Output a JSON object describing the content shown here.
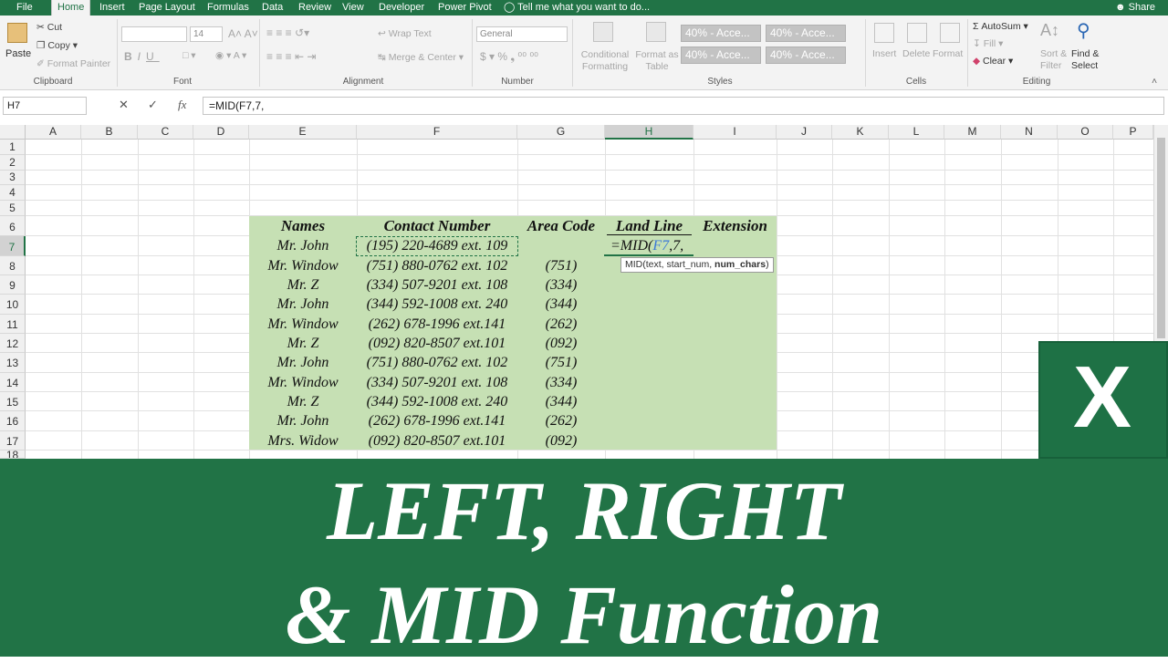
{
  "ribbon_tabs": [
    "File",
    "Home",
    "Insert",
    "Page Layout",
    "Formulas",
    "Data",
    "Review",
    "View",
    "Developer",
    "Power Pivot"
  ],
  "tell_me": "Tell me what you want to do...",
  "share": "Share",
  "clipboard": {
    "paste": "Paste",
    "cut": "Cut",
    "copy": "Copy",
    "format_painter": "Format Painter",
    "label": "Clipboard"
  },
  "font": {
    "size": "14",
    "label": "Font"
  },
  "alignment": {
    "wrap": "Wrap Text",
    "merge": "Merge & Center",
    "label": "Alignment"
  },
  "number": {
    "format": "General",
    "label": "Number"
  },
  "styles": {
    "conditional": "Conditional Formatting",
    "format_table": "Format as Table",
    "cell_styles": [
      "40% - Acce...",
      "40% - Acce...",
      "40% - Acce...",
      "40% - Acce..."
    ],
    "label": "Styles"
  },
  "cells": {
    "insert": "Insert",
    "delete": "Delete",
    "format": "Format",
    "label": "Cells"
  },
  "editing": {
    "autosum": "AutoSum",
    "fill": "Fill",
    "clear": "Clear",
    "sort": "Sort & Filter",
    "find": "Find & Select",
    "label": "Editing"
  },
  "formula_bar": {
    "name_box": "H7",
    "formula": "=MID(F7,7,"
  },
  "columns": [
    "A",
    "B",
    "C",
    "D",
    "E",
    "F",
    "G",
    "H",
    "I",
    "J",
    "K",
    "L",
    "M",
    "N",
    "O",
    "P"
  ],
  "rows": [
    "1",
    "2",
    "3",
    "4",
    "5",
    "6",
    "7",
    "8",
    "9",
    "10",
    "11",
    "12",
    "13",
    "14",
    "15",
    "16",
    "17",
    "18"
  ],
  "table": {
    "headers": [
      "Names",
      "Contact Number",
      "Area Code",
      "Land Line",
      "Extension"
    ],
    "rows": [
      {
        "name": "Mr. John",
        "contact": "(195) 220-4689 ext. 109",
        "area": ""
      },
      {
        "name": "Mr. Window",
        "contact": "(751) 880-0762 ext. 102",
        "area": "(751)"
      },
      {
        "name": "Mr. Z",
        "contact": "(334) 507-9201 ext. 108",
        "area": "(334)"
      },
      {
        "name": "Mr. John",
        "contact": "(344) 592-1008 ext. 240",
        "area": "(344)"
      },
      {
        "name": "Mr. Window",
        "contact": "(262) 678-1996 ext.141",
        "area": "(262)"
      },
      {
        "name": "Mr. Z",
        "contact": "(092) 820-8507 ext.101",
        "area": "(092)"
      },
      {
        "name": "Mr. John",
        "contact": "(751) 880-0762 ext. 102",
        "area": "(751)"
      },
      {
        "name": "Mr. Window",
        "contact": "(334) 507-9201 ext. 108",
        "area": "(334)"
      },
      {
        "name": "Mr. Z",
        "contact": "(344) 592-1008 ext. 240",
        "area": "(344)"
      },
      {
        "name": "Mr. John",
        "contact": "(262) 678-1996 ext.141",
        "area": "(262)"
      },
      {
        "name": "Mrs. Widow",
        "contact": "(092) 820-8507 ext.101",
        "area": "(092)"
      }
    ],
    "active_cell_formula": {
      "prefix": "=MID(",
      "ref": "F7",
      "suffix": ",7,"
    },
    "tooltip": {
      "text": "MID(text, start_num, ",
      "bold": "num_chars",
      "end": ")"
    }
  },
  "banner": {
    "line1": "LEFT, RIGHT",
    "line2": "& MID Function"
  },
  "logo_letter": "X",
  "colors": {
    "excel_green": "#217346",
    "table_fill": "#c6e0b4",
    "ref_blue": "#3c78d8"
  }
}
